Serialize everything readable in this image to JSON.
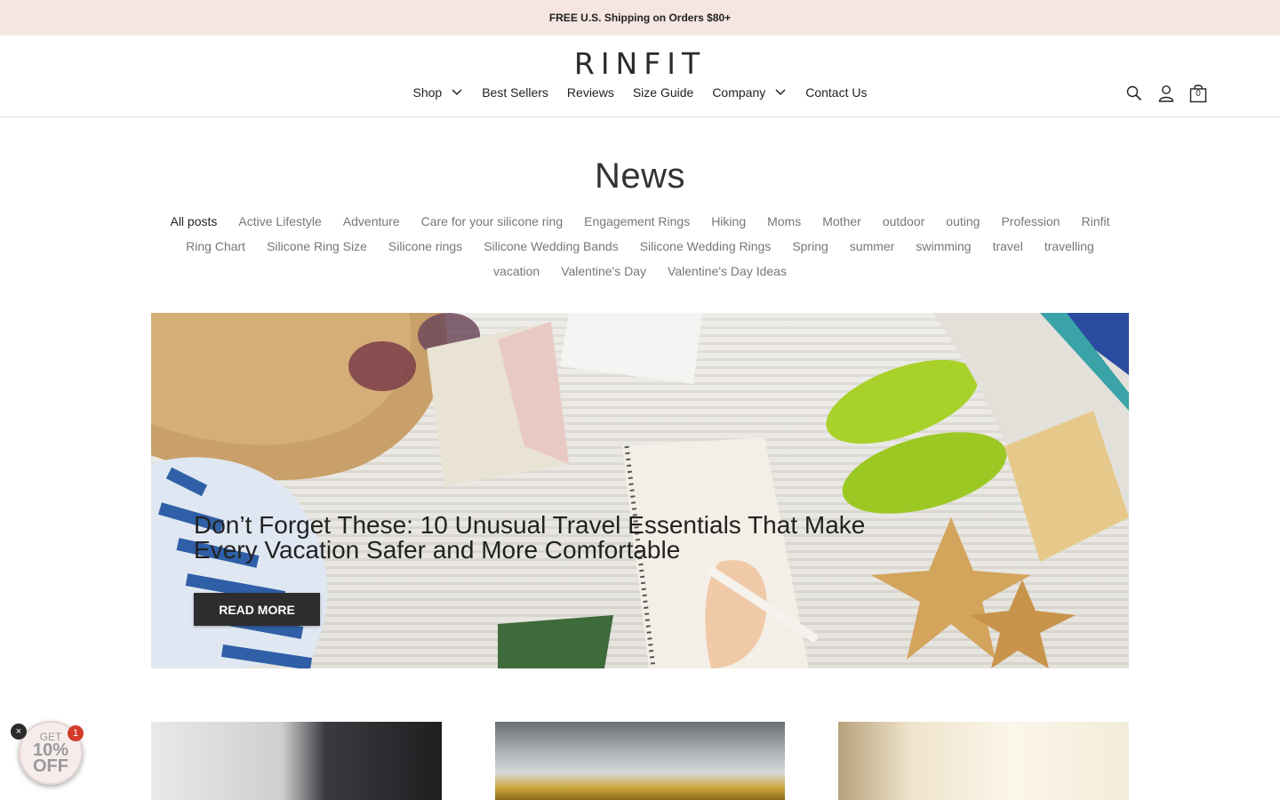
{
  "announcement": "FREE U.S. Shipping on Orders $80+",
  "brand": "RINFIT",
  "nav": {
    "items": [
      {
        "label": "Shop",
        "has_dropdown": true
      },
      {
        "label": "Best Sellers",
        "has_dropdown": false
      },
      {
        "label": "Reviews",
        "has_dropdown": false
      },
      {
        "label": "Size Guide",
        "has_dropdown": false
      },
      {
        "label": "Company",
        "has_dropdown": true
      },
      {
        "label": "Contact Us",
        "has_dropdown": false
      }
    ]
  },
  "header_icons": {
    "search": "search-icon",
    "account": "user-icon",
    "cart": "cart-icon",
    "cart_count": "0"
  },
  "page_title": "News",
  "tags": [
    "All posts",
    "Active Lifestyle",
    "Adventure",
    "Care for your silicone ring",
    "Engagement Rings",
    "Hiking",
    "Moms",
    "Mother",
    "outdoor",
    "outing",
    "Profession",
    "Rinfit",
    "Ring Chart",
    "Silicone Ring Size",
    "Silicone rings",
    "Silicone Wedding Bands",
    "Silicone Wedding Rings",
    "Spring",
    "summer",
    "swimming",
    "travel",
    "travelling",
    "vacation",
    "Valentine's Day",
    "Valentine's Day Ideas"
  ],
  "active_tag": "All posts",
  "hero": {
    "title": "Don’t Forget These: 10 Unusual Travel Essentials That Make Every Vacation Safer and More Comfortable",
    "button": "READ MORE"
  },
  "promo": {
    "line1": "GET",
    "line2": "10%",
    "line3": "OFF",
    "badge": "1",
    "close": "×"
  },
  "colors": {
    "announcement_bg": "#f5e6e2",
    "button_bg": "#2d2d2d",
    "badge": "#d33b2c"
  }
}
